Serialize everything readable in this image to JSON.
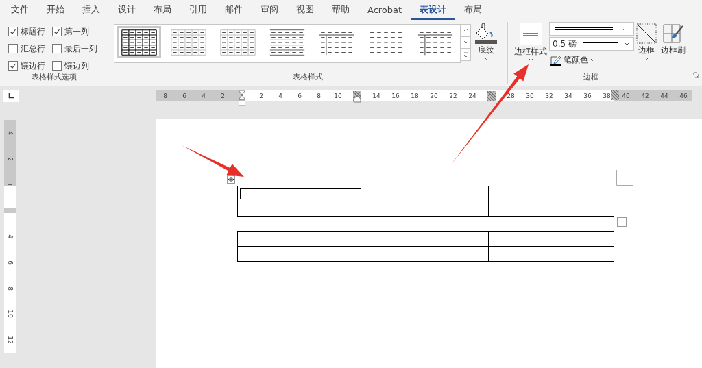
{
  "menu_tabs": [
    {
      "label": "文件",
      "selected": false
    },
    {
      "label": "开始",
      "selected": false
    },
    {
      "label": "插入",
      "selected": false
    },
    {
      "label": "设计",
      "selected": false
    },
    {
      "label": "布局",
      "selected": false
    },
    {
      "label": "引用",
      "selected": false
    },
    {
      "label": "邮件",
      "selected": false
    },
    {
      "label": "审阅",
      "selected": false
    },
    {
      "label": "视图",
      "selected": false
    },
    {
      "label": "帮助",
      "selected": false
    },
    {
      "label": "Acrobat",
      "selected": false
    },
    {
      "label": "表设计",
      "selected": true
    },
    {
      "label": "布局",
      "selected": false
    }
  ],
  "table_style_options": {
    "title": "表格样式选项",
    "checkboxes": [
      {
        "label": "标题行",
        "checked": true
      },
      {
        "label": "第一列",
        "checked": true
      },
      {
        "label": "汇总行",
        "checked": false
      },
      {
        "label": "最后一列",
        "checked": false
      },
      {
        "label": "镶边行",
        "checked": true
      },
      {
        "label": "镶边列",
        "checked": false
      }
    ]
  },
  "table_styles": {
    "title": "表格样式",
    "styles": [
      {
        "kind": "grid-bold",
        "selected": true
      },
      {
        "kind": "grid-light",
        "selected": false
      },
      {
        "kind": "grid-light",
        "selected": false
      },
      {
        "kind": "lines",
        "selected": false
      },
      {
        "kind": "header-col",
        "selected": false
      },
      {
        "kind": "plain",
        "selected": false
      },
      {
        "kind": "header-col",
        "selected": false
      }
    ],
    "shading": {
      "label": "底纹"
    }
  },
  "borders": {
    "title": "边框",
    "border_styles": {
      "label": "边框样式"
    },
    "pen_weight": "0.5 磅",
    "pen_color": {
      "label": "笔颜色"
    },
    "borders_button": {
      "label": "边框"
    },
    "border_painter": {
      "label": "边框刷"
    }
  },
  "horizontal_ruler": [
    {
      "kind": "number",
      "text": "8"
    },
    {
      "kind": "number",
      "text": "6"
    },
    {
      "kind": "number",
      "text": "4"
    },
    {
      "kind": "number",
      "text": "2"
    },
    {
      "kind": "indent"
    },
    {
      "kind": "number",
      "text": "2"
    },
    {
      "kind": "number",
      "text": "4"
    },
    {
      "kind": "number",
      "text": "6"
    },
    {
      "kind": "number",
      "text": "8"
    },
    {
      "kind": "number",
      "text": "10"
    },
    {
      "kind": "column"
    },
    {
      "kind": "number",
      "text": "14"
    },
    {
      "kind": "number",
      "text": "16"
    },
    {
      "kind": "number",
      "text": "18"
    },
    {
      "kind": "number",
      "text": "20"
    },
    {
      "kind": "number",
      "text": "22"
    },
    {
      "kind": "number",
      "text": "24"
    },
    {
      "kind": "column"
    },
    {
      "kind": "number",
      "text": "28"
    },
    {
      "kind": "number",
      "text": "30"
    },
    {
      "kind": "number",
      "text": "32"
    },
    {
      "kind": "number",
      "text": "34"
    },
    {
      "kind": "number",
      "text": "36"
    },
    {
      "kind": "number",
      "text": "38"
    },
    {
      "kind": "number",
      "text": "40"
    },
    {
      "kind": "number",
      "text": "42"
    },
    {
      "kind": "number",
      "text": "44"
    },
    {
      "kind": "number",
      "text": "46"
    }
  ],
  "vertical_ruler": [
    {
      "kind": "number",
      "text": "4"
    },
    {
      "kind": "number",
      "text": "2"
    },
    {
      "kind": "tick"
    },
    {
      "kind": "band"
    },
    {
      "kind": "number",
      "text": "4"
    },
    {
      "kind": "number",
      "text": "6"
    },
    {
      "kind": "number",
      "text": "8"
    },
    {
      "kind": "number",
      "text": "10"
    },
    {
      "kind": "number",
      "text": "12"
    }
  ],
  "document_tables": [
    {
      "rows": [
        {
          "cells": [
            {
              "kind": "double-border"
            },
            {
              "kind": "plain"
            },
            {
              "kind": "plain"
            }
          ]
        },
        {
          "cells": [
            {
              "kind": "plain"
            },
            {
              "kind": "plain"
            },
            {
              "kind": "plain"
            }
          ]
        }
      ]
    },
    {
      "rows": [
        {
          "cells": [
            {
              "kind": "plain"
            },
            {
              "kind": "plain"
            },
            {
              "kind": "plain"
            }
          ]
        },
        {
          "cells": [
            {
              "kind": "plain"
            },
            {
              "kind": "plain"
            },
            {
              "kind": "plain"
            }
          ]
        }
      ]
    }
  ],
  "annotations": [
    {
      "kind": "red-arrow"
    },
    {
      "kind": "red-arrow"
    }
  ]
}
